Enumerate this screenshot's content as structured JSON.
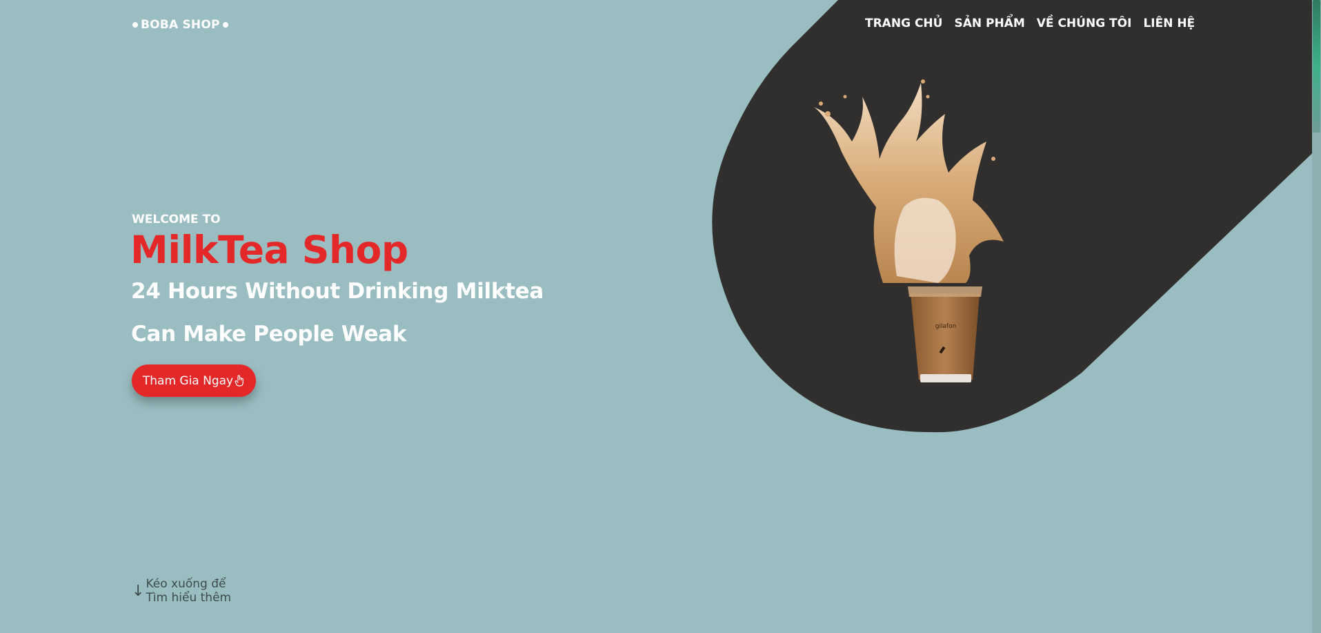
{
  "logo": {
    "text": "BOBA SHOP"
  },
  "nav": {
    "items": [
      {
        "label": "TRANG CHỦ"
      },
      {
        "label": "SẢN PHẨM"
      },
      {
        "label": "VỀ CHÚNG TÔI"
      },
      {
        "label": "LIÊN HỆ"
      }
    ]
  },
  "hero": {
    "welcome": "WELCOME TO",
    "title": "MilkTea Shop",
    "tagline_line1": "24 Hours Without Drinking Milktea",
    "tagline_line2": "Can Make People Weak",
    "cta_label": "Tham Gia Ngay",
    "cup_brand": "gilafon"
  },
  "scroll_hint": {
    "line1": "Kéo xuống để",
    "line2": "Tìm hiểu thêm"
  },
  "colors": {
    "background": "#9abdc1",
    "dark_shape": "#312f2e",
    "accent_red": "#e42829",
    "text_light": "#ffffff"
  },
  "icons": {
    "cta_icon": "hand-pointer-icon",
    "scroll_icon": "arrow-down-icon"
  }
}
